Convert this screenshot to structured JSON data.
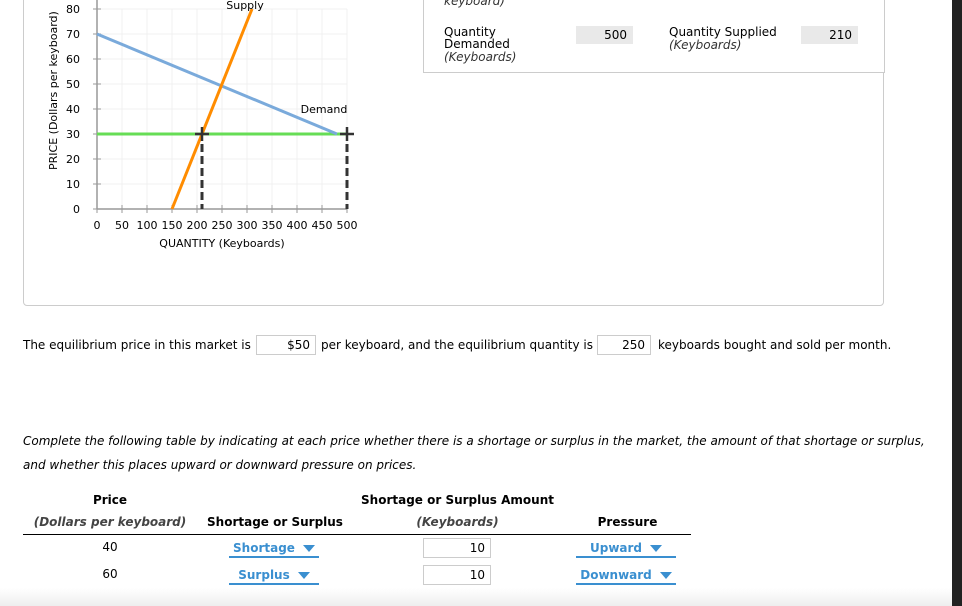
{
  "chart_data": {
    "type": "line",
    "xlabel": "QUANTITY (Keyboards)",
    "ylabel": "PRICE (Dollars per keyboard)",
    "xlim": [
      0,
      500
    ],
    "ylim": [
      0,
      80
    ],
    "xticks": [
      0,
      50,
      100,
      150,
      200,
      250,
      300,
      350,
      400,
      450,
      500
    ],
    "yticks": [
      0,
      10,
      20,
      30,
      40,
      50,
      60,
      70,
      80
    ],
    "grid": true,
    "series": [
      {
        "name": "Supply",
        "color": "#ff8c00",
        "points": [
          [
            150,
            0
          ],
          [
            310,
            80
          ]
        ]
      },
      {
        "name": "Demand",
        "color": "#7aaadb",
        "points": [
          [
            0,
            70
          ],
          [
            480,
            30
          ]
        ]
      },
      {
        "name": "",
        "color": "#66dd55",
        "points": [
          [
            0,
            30
          ],
          [
            500,
            30
          ]
        ]
      }
    ],
    "markers": [
      [
        210,
        30
      ],
      [
        500,
        30
      ]
    ]
  },
  "info": {
    "price_label_partial": "keyboard)",
    "qd_label": "Quantity Demanded",
    "qd_unit": "(Keyboards)",
    "qd_value": "500",
    "qs_label": "Quantity Supplied",
    "qs_unit": "(Keyboards)",
    "qs_value": "210"
  },
  "sentence": {
    "part1": "The equilibrium price in this market is",
    "price": "$50",
    "part2": "per keyboard, and the equilibrium quantity is",
    "quantity": "250",
    "part3": "keyboards bought and sold per month."
  },
  "instructions": "Complete the following table by indicating at each price whether there is a shortage or surplus in the market, the amount of that shortage or surplus, and whether this places upward or downward pressure on prices.",
  "table": {
    "headers": {
      "price": "Price",
      "price_unit": "(Dollars per keyboard)",
      "type": "Shortage or Surplus",
      "amount": "Shortage or Surplus Amount",
      "amount_unit": "(Keyboards)",
      "pressure": "Pressure"
    },
    "rows": [
      {
        "price": "40",
        "type": "Shortage",
        "amount": "10",
        "pressure": "Upward"
      },
      {
        "price": "60",
        "type": "Surplus",
        "amount": "10",
        "pressure": "Downward"
      }
    ]
  }
}
